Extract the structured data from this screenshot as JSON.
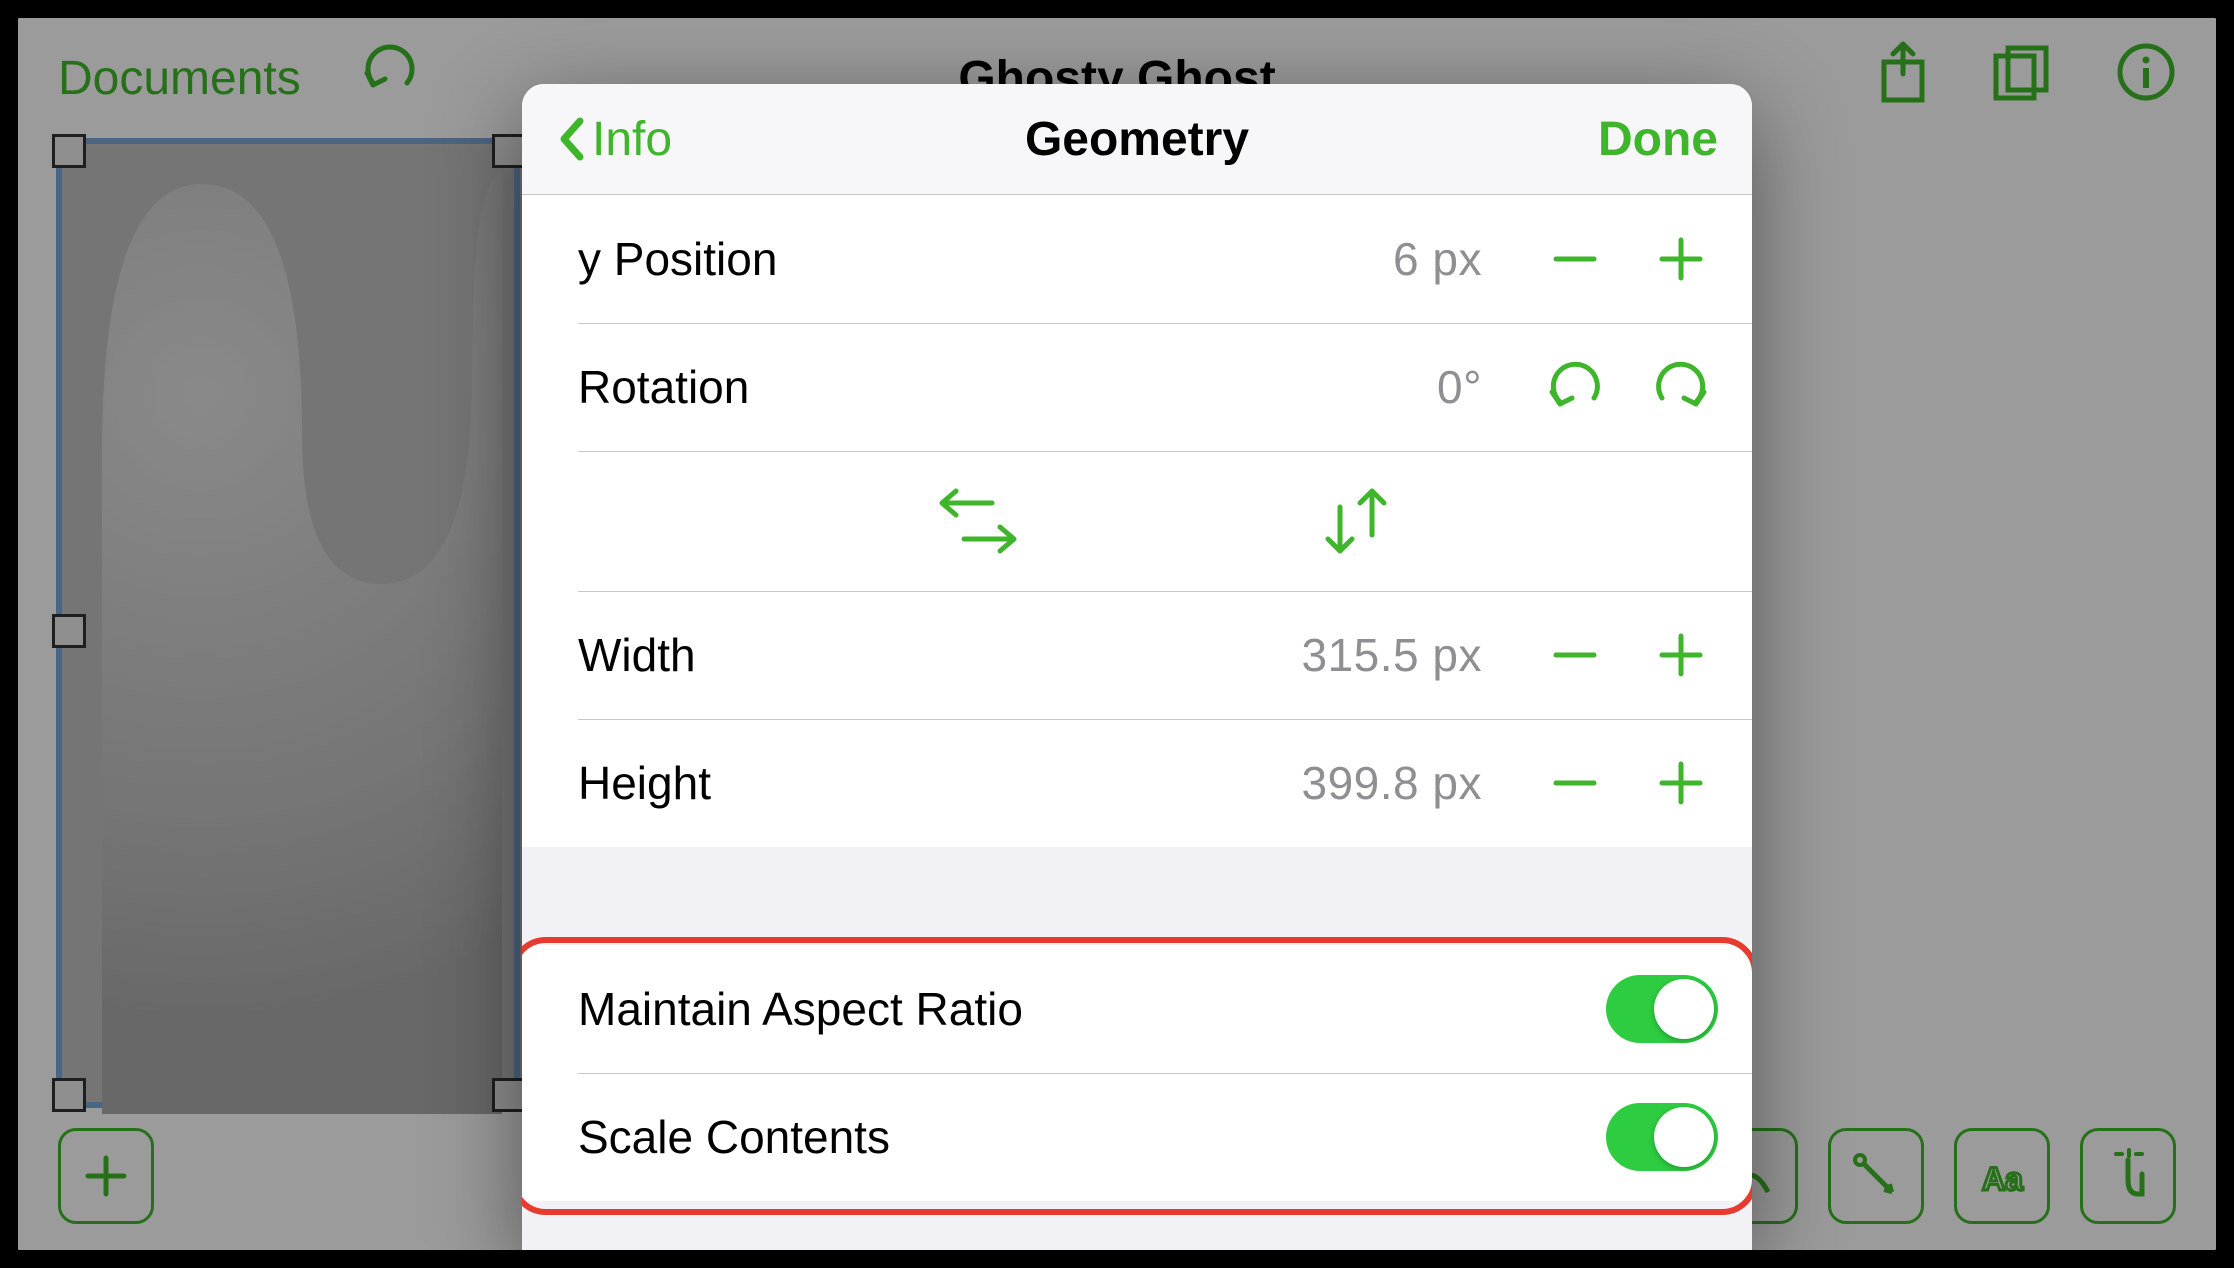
{
  "bg": {
    "documents_label": "Documents",
    "doc_title": "Ghosty Ghost"
  },
  "popover": {
    "back_label": "Info",
    "title": "Geometry",
    "done_label": "Done",
    "rows": {
      "y_position": {
        "label": "y Position",
        "value": "6 px"
      },
      "rotation": {
        "label": "Rotation",
        "value": "0°"
      },
      "width": {
        "label": "Width",
        "value": "315.5 px"
      },
      "height": {
        "label": "Height",
        "value": "399.8 px"
      }
    },
    "toggles": {
      "aspect": {
        "label": "Maintain Aspect Ratio",
        "on": true
      },
      "scale": {
        "label": "Scale Contents",
        "on": true
      }
    }
  },
  "colors": {
    "accent": "#3eb52a"
  }
}
